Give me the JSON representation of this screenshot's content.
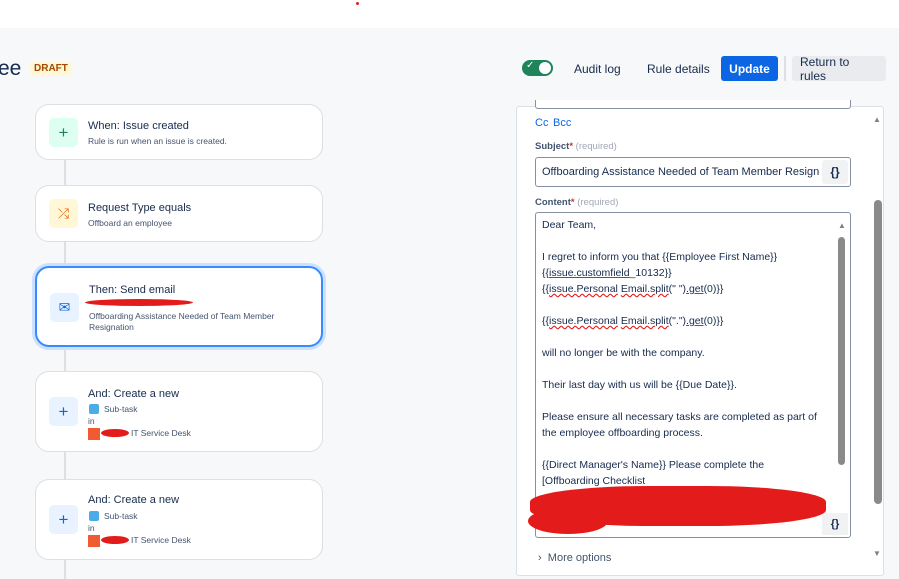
{
  "header": {
    "title": "ee",
    "badge": "DRAFT",
    "audit_log": "Audit log",
    "rule_details": "Rule details",
    "update": "Update",
    "return": "Return to rules",
    "enabled": true
  },
  "flow": [
    {
      "title": "When: Issue created",
      "subtitle": "Rule is run when an issue is created.",
      "icon": "plus-icon"
    },
    {
      "title": "Request Type equals",
      "subtitle": "Offboard an employee",
      "icon": "shuffle-icon"
    },
    {
      "title": "Then: Send email",
      "subtitle": "Offboarding Assistance Needed of Team Member Resignation",
      "icon": "mail-icon"
    },
    {
      "title": "And: Create a new",
      "type": "Sub-task",
      "in": "in",
      "project": "IT Service Desk",
      "icon": "plus-icon"
    },
    {
      "title": "And: Create a new",
      "type": "Sub-task",
      "in": "in",
      "project": "IT Service Desk",
      "icon": "plus-icon"
    }
  ],
  "panel": {
    "cc": "Cc",
    "bcc": "Bcc",
    "subject_label": "Subject",
    "required": "(required)",
    "star": "*",
    "subject_value": "Offboarding Assistance Needed of Team Member Resignr",
    "smart_values": "{}",
    "content_label": "Content",
    "content": {
      "l1": "Dear Team,",
      "l2": "I regret to inform you that {{Employee First Name}}",
      "l3a": "{{",
      "l3b": "issue.customfield",
      "l3c": "_10132}}",
      "l4a": "{{",
      "l4b": "issue.Personal",
      "l4c": " ",
      "l4d": "Email.split",
      "l4e": "(\" \")",
      "l4f": ".get",
      "l4g": "(0)}}",
      "l5a": "{{",
      "l5b": "issue.Personal",
      "l5c": " ",
      "l5d": "Email.split",
      "l5e": "(\".\")",
      "l5f": ".get",
      "l5g": "(0)}}",
      "l6": "will no longer be with the company.",
      "l7": "Their last day with us will be {{Due Date}}.",
      "l8": "Please ensure all necessary tasks are completed as part of\nthe employee offboarding process.",
      "l9": "{{Direct Manager's Name}} Please complete the\n[Offboarding Checklist"
    },
    "more_options": "More options"
  }
}
